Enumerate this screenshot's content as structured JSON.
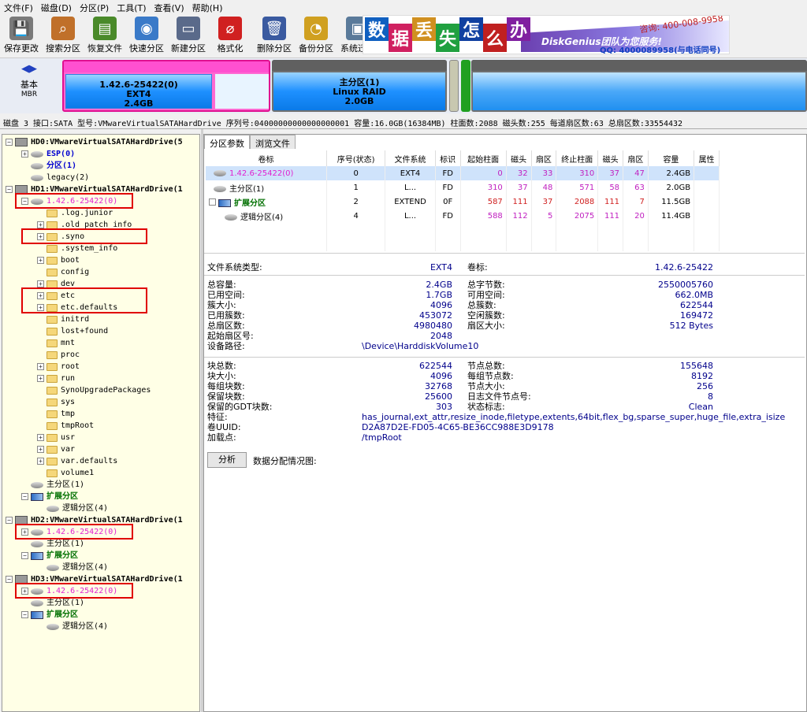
{
  "menu": [
    "文件(F)",
    "磁盘(D)",
    "分区(P)",
    "工具(T)",
    "查看(V)",
    "帮助(H)"
  ],
  "toolbar": [
    {
      "label": "保存更改",
      "icon": "save-icon",
      "color": "#7a7a7a"
    },
    {
      "label": "搜索分区",
      "icon": "search-icon",
      "color": "#c0702a"
    },
    {
      "label": "恢复文件",
      "icon": "recover-icon",
      "color": "#4a8a2a"
    },
    {
      "label": "快速分区",
      "icon": "disk-icon",
      "color": "#3a7ac8"
    },
    {
      "label": "新建分区",
      "icon": "new-partition-icon",
      "color": "#5a6a8a"
    },
    {
      "label": "格式化",
      "icon": "format-icon",
      "color": "#d02020"
    },
    {
      "label": "删除分区",
      "icon": "delete-icon",
      "color": "#3a5aa0"
    },
    {
      "label": "备份分区",
      "icon": "backup-icon",
      "color": "#d0a020"
    },
    {
      "label": "系统迁移",
      "icon": "migrate-icon",
      "color": "#5a7a9a"
    }
  ],
  "ad": {
    "chars": [
      "数",
      "据",
      "丢",
      "失",
      "怎",
      "么",
      "办"
    ],
    "brand": "DiskGenius团队为您服务!",
    "phone": "咨询: 400-008-9958",
    "qq": "QQ: 4000089958(与电话同号)"
  },
  "diskmap": {
    "label1": "基本",
    "label2": "MBR",
    "p1": {
      "name": "1.42.6-25422(0)",
      "fs": "EXT4",
      "size": "2.4GB"
    },
    "p2": {
      "name": "主分区(1)",
      "fs": "Linux RAID",
      "size": "2.0GB"
    }
  },
  "diskinfo": "磁盘 3 接口:SATA  型号:VMwareVirtualSATAHardDrive  序列号:04000000000000000001  容量:16.0GB(16384MB)  柱面数:2088  磁头数:255  每道扇区数:63  总扇区数:33554432",
  "tree": [
    {
      "t": "HD0:VMwareVirtualSATAHardDrive(5",
      "ind": 0,
      "exp": "-",
      "icon": "hicon",
      "cls": "bold"
    },
    {
      "t": "ESP(0)",
      "ind": 1,
      "exp": "+",
      "icon": "picon",
      "cls": "bold blue"
    },
    {
      "t": "分区(1)",
      "ind": 1,
      "exp": "",
      "icon": "picon",
      "cls": "bold blue"
    },
    {
      "t": "legacy(2)",
      "ind": 1,
      "exp": "",
      "icon": "picon",
      "cls": ""
    },
    {
      "t": "HD1:VMwareVirtualSATAHardDrive(1",
      "ind": 0,
      "exp": "-",
      "icon": "hicon",
      "cls": "bold"
    },
    {
      "t": "1.42.6-25422(0)",
      "ind": 1,
      "exp": "-",
      "icon": "picon",
      "cls": "magenta"
    },
    {
      "t": ".log.junior",
      "ind": 2,
      "exp": "",
      "icon": "ficon",
      "cls": ""
    },
    {
      "t": ".old_patch_info",
      "ind": 2,
      "exp": "+",
      "icon": "ficon",
      "cls": ""
    },
    {
      "t": ".syno",
      "ind": 2,
      "exp": "+",
      "icon": "ficon",
      "cls": ""
    },
    {
      "t": ".system_info",
      "ind": 2,
      "exp": "",
      "icon": "ficon",
      "cls": ""
    },
    {
      "t": "boot",
      "ind": 2,
      "exp": "+",
      "icon": "ficon",
      "cls": ""
    },
    {
      "t": "config",
      "ind": 2,
      "exp": "",
      "icon": "ficon",
      "cls": ""
    },
    {
      "t": "dev",
      "ind": 2,
      "exp": "+",
      "icon": "ficon",
      "cls": ""
    },
    {
      "t": "etc",
      "ind": 2,
      "exp": "+",
      "icon": "ficon",
      "cls": ""
    },
    {
      "t": "etc.defaults",
      "ind": 2,
      "exp": "+",
      "icon": "ficon",
      "cls": ""
    },
    {
      "t": "initrd",
      "ind": 2,
      "exp": "",
      "icon": "ficon",
      "cls": ""
    },
    {
      "t": "lost+found",
      "ind": 2,
      "exp": "",
      "icon": "ficon",
      "cls": ""
    },
    {
      "t": "mnt",
      "ind": 2,
      "exp": "",
      "icon": "ficon",
      "cls": ""
    },
    {
      "t": "proc",
      "ind": 2,
      "exp": "",
      "icon": "ficon",
      "cls": ""
    },
    {
      "t": "root",
      "ind": 2,
      "exp": "+",
      "icon": "ficon",
      "cls": ""
    },
    {
      "t": "run",
      "ind": 2,
      "exp": "+",
      "icon": "ficon",
      "cls": ""
    },
    {
      "t": "SynoUpgradePackages",
      "ind": 2,
      "exp": "",
      "icon": "ficon",
      "cls": ""
    },
    {
      "t": "sys",
      "ind": 2,
      "exp": "",
      "icon": "ficon",
      "cls": ""
    },
    {
      "t": "tmp",
      "ind": 2,
      "exp": "",
      "icon": "ficon",
      "cls": ""
    },
    {
      "t": "tmpRoot",
      "ind": 2,
      "exp": "",
      "icon": "ficon",
      "cls": ""
    },
    {
      "t": "usr",
      "ind": 2,
      "exp": "+",
      "icon": "ficon",
      "cls": ""
    },
    {
      "t": "var",
      "ind": 2,
      "exp": "+",
      "icon": "ficon",
      "cls": ""
    },
    {
      "t": "var.defaults",
      "ind": 2,
      "exp": "+",
      "icon": "ficon",
      "cls": ""
    },
    {
      "t": "volume1",
      "ind": 2,
      "exp": "",
      "icon": "ficon",
      "cls": ""
    },
    {
      "t": "主分区(1)",
      "ind": 1,
      "exp": "",
      "icon": "picon",
      "cls": ""
    },
    {
      "t": "扩展分区",
      "ind": 1,
      "exp": "-",
      "icon": "eicon",
      "cls": "bold green"
    },
    {
      "t": "逻辑分区(4)",
      "ind": 2,
      "exp": "",
      "icon": "picon",
      "cls": ""
    },
    {
      "t": "HD2:VMwareVirtualSATAHardDrive(1",
      "ind": 0,
      "exp": "-",
      "icon": "hicon",
      "cls": "bold"
    },
    {
      "t": "1.42.6-25422(0)",
      "ind": 1,
      "exp": "+",
      "icon": "picon",
      "cls": "magenta"
    },
    {
      "t": "主分区(1)",
      "ind": 1,
      "exp": "",
      "icon": "picon",
      "cls": ""
    },
    {
      "t": "扩展分区",
      "ind": 1,
      "exp": "-",
      "icon": "eicon",
      "cls": "bold green"
    },
    {
      "t": "逻辑分区(4)",
      "ind": 2,
      "exp": "",
      "icon": "picon",
      "cls": ""
    },
    {
      "t": "HD3:VMwareVirtualSATAHardDrive(1",
      "ind": 0,
      "exp": "-",
      "icon": "hicon",
      "cls": "bold"
    },
    {
      "t": "1.42.6-25422(0)",
      "ind": 1,
      "exp": "+",
      "icon": "picon",
      "cls": "magenta"
    },
    {
      "t": "主分区(1)",
      "ind": 1,
      "exp": "",
      "icon": "picon",
      "cls": ""
    },
    {
      "t": "扩展分区",
      "ind": 1,
      "exp": "-",
      "icon": "eicon",
      "cls": "bold green"
    },
    {
      "t": "逻辑分区(4)",
      "ind": 2,
      "exp": "",
      "icon": "picon",
      "cls": ""
    }
  ],
  "tabs": [
    "分区参数",
    "浏览文件"
  ],
  "table": {
    "headers": [
      "卷标",
      "序号(状态)",
      "文件系统",
      "标识",
      "起始柱面",
      "磁头",
      "扇区",
      "终止柱面",
      "磁头",
      "扇区",
      "容量",
      "属性"
    ],
    "rows": [
      [
        "1.42.6-25422(0)",
        "0",
        "EXT4",
        "FD",
        "0",
        "32",
        "33",
        "310",
        "37",
        "47",
        "2.4GB",
        ""
      ],
      [
        "主分区(1)",
        "1",
        "L...",
        "FD",
        "310",
        "37",
        "48",
        "571",
        "58",
        "63",
        "2.0GB",
        ""
      ],
      [
        "扩展分区",
        "2",
        "EXTEND",
        "0F",
        "587",
        "111",
        "37",
        "2088",
        "111",
        "7",
        "11.5GB",
        ""
      ],
      [
        "逻辑分区(4)",
        "4",
        "L...",
        "FD",
        "588",
        "112",
        "5",
        "2075",
        "111",
        "20",
        "11.4GB",
        ""
      ]
    ]
  },
  "fsinfo": {
    "l1": [
      [
        "文件系统类型:",
        "EXT4"
      ]
    ],
    "r1": [
      [
        "卷标:",
        "1.42.6-25422"
      ]
    ],
    "l2": [
      [
        "总容量:",
        "2.4GB"
      ],
      [
        "已用空间:",
        "1.7GB"
      ],
      [
        "簇大小:",
        "4096"
      ],
      [
        "已用簇数:",
        "453072"
      ],
      [
        "总扇区数:",
        "4980480"
      ],
      [
        "起始扇区号:",
        "2048"
      ],
      [
        "设备路径:",
        "\\Device\\HarddiskVolume10"
      ]
    ],
    "r2": [
      [
        "总字节数:",
        "2550005760"
      ],
      [
        "可用空间:",
        "662.0MB"
      ],
      [
        "总簇数:",
        "622544"
      ],
      [
        "空闲簇数:",
        "169472"
      ],
      [
        "扇区大小:",
        "512 Bytes"
      ]
    ],
    "l3": [
      [
        "块总数:",
        "622544"
      ],
      [
        "块大小:",
        "4096"
      ],
      [
        "每组块数:",
        "32768"
      ],
      [
        "保留块数:",
        "25600"
      ],
      [
        "保留的GDT块数:",
        "303"
      ],
      [
        "特征:",
        "has_journal,ext_attr,resize_inode,filetype,extents,64bit,flex_bg,sparse_super,huge_file,extra_isize"
      ],
      [
        "卷UUID:",
        "D2A87D2E-FD05-4C65-BE36CC988E3D9178"
      ],
      [
        "加载点:",
        "/tmpRoot"
      ]
    ],
    "r3": [
      [
        "节点总数:",
        "155648"
      ],
      [
        "每组节点数:",
        "8192"
      ],
      [
        "节点大小:",
        "256"
      ],
      [
        "日志文件节点号:",
        "8"
      ],
      [
        "状态标志:",
        "Clean"
      ]
    ]
  },
  "analyze": {
    "button": "分析",
    "label": "数据分配情况图:"
  }
}
